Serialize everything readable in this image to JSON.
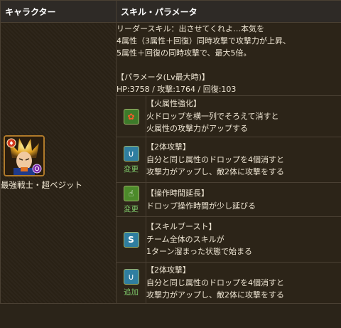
{
  "header": {
    "col1": "キャラクター",
    "col2": "スキル・パラメータ"
  },
  "character": {
    "name": "最強戦士・超ベジット"
  },
  "skill": {
    "leader_lines": [
      "リーダースキル：出させてくれよ…本気を",
      "4属性（3属性＋回復）同時攻撃で攻撃力が上昇、",
      "5属性＋回復の同時攻撃で、最大5倍。"
    ],
    "param_label": "【パラメータ(Lv最大時)】",
    "param_values": "HP:3758 / 攻撃:1764 / 回復:103"
  },
  "awakenings": [
    {
      "icon": "fire-orb-enhance-icon",
      "icon_glyph": "✿",
      "icon_bg": "#3d7a2a",
      "icon_color": "#ff5a2a",
      "sub": "",
      "title": "【火属性強化】",
      "lines": [
        "火ドロップを横一列でそろえて消すと",
        "火属性の攻撃力がアップする"
      ]
    },
    {
      "icon": "two-way-attack-icon",
      "icon_glyph": "∪",
      "icon_bg": "#2f7ea0",
      "icon_color": "#ffffff",
      "sub": "変更",
      "title": "【2体攻撃】",
      "lines": [
        "自分と同じ属性のドロップを4個消すと",
        "攻撃力がアップし、敵2体に攻撃をする"
      ]
    },
    {
      "icon": "time-extend-icon",
      "icon_glyph": "☝",
      "icon_bg": "#4c8a2a",
      "icon_color": "#ffffff",
      "sub": "変更",
      "title": "【操作時間延長】",
      "lines": [
        "ドロップ操作時間が少し延びる"
      ]
    },
    {
      "icon": "skill-boost-icon",
      "icon_glyph": "S",
      "icon_bg": "#2f7ea0",
      "icon_color": "#ffffff",
      "sub": "",
      "title": "【スキルブースト】",
      "lines": [
        "チーム全体のスキルが",
        "1ターン溜まった状態で始まる"
      ]
    },
    {
      "icon": "two-way-attack-icon",
      "icon_glyph": "∪",
      "icon_bg": "#2f7ea0",
      "icon_color": "#ffffff",
      "sub": "追加",
      "title": "【2体攻撃】",
      "lines": [
        "自分と同じ属性のドロップを4個消すと",
        "攻撃力がアップし、敵2体に攻撃をする"
      ]
    }
  ]
}
